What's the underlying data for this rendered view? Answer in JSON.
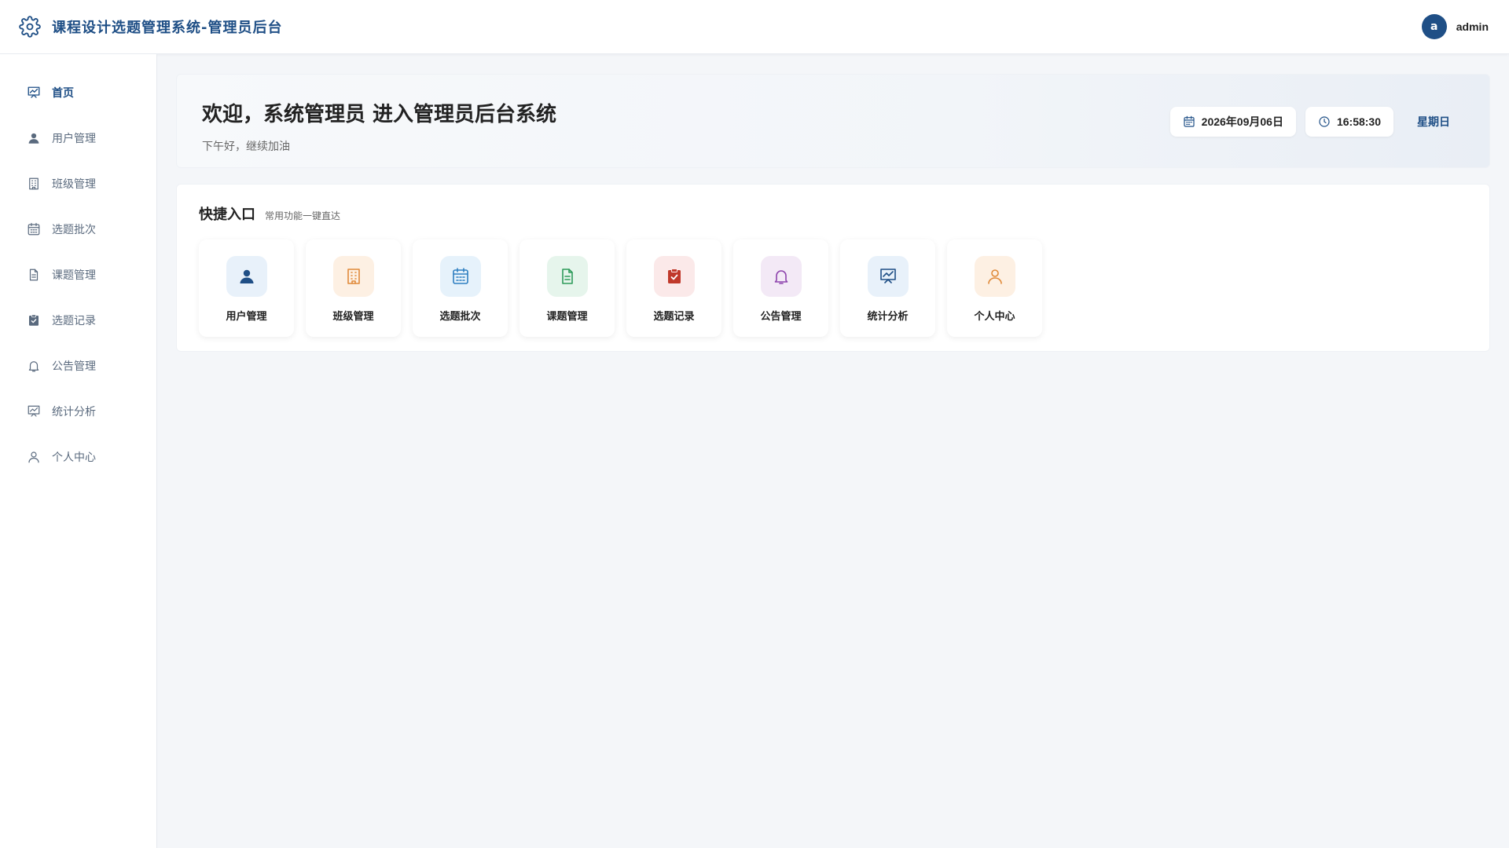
{
  "header": {
    "title": "课程设计选题管理系统-管理员后台",
    "avatar_letter": "a",
    "username": "admin"
  },
  "sidebar": {
    "items": [
      {
        "label": "首页",
        "icon": "chart-board-icon",
        "active": true
      },
      {
        "label": "用户管理",
        "icon": "user-icon"
      },
      {
        "label": "班级管理",
        "icon": "building-icon"
      },
      {
        "label": "选题批次",
        "icon": "calendar-icon"
      },
      {
        "label": "课题管理",
        "icon": "document-icon"
      },
      {
        "label": "选题记录",
        "icon": "clipboard-check-icon"
      },
      {
        "label": "公告管理",
        "icon": "bell-icon"
      },
      {
        "label": "统计分析",
        "icon": "chart-board-icon"
      },
      {
        "label": "个人中心",
        "icon": "person-outline-icon"
      }
    ]
  },
  "welcome": {
    "title": "欢迎，系统管理员 进入管理员后台系统",
    "subtitle": "下午好，继续加油",
    "date": "2026年09月06日",
    "time": "16:58:30",
    "weekday": "星期日"
  },
  "quick": {
    "title": "快捷入口",
    "subtitle": "常用功能一键直达",
    "cards": [
      {
        "label": "用户管理",
        "icon": "user-icon",
        "bg": "#e8f1fa",
        "color": "#1f4f86"
      },
      {
        "label": "班级管理",
        "icon": "building-icon",
        "bg": "#fdf0e3",
        "color": "#e08a3a"
      },
      {
        "label": "选题批次",
        "icon": "calendar-icon",
        "bg": "#e6f2fb",
        "color": "#2f7fc1"
      },
      {
        "label": "课题管理",
        "icon": "document-icon",
        "bg": "#e6f5ec",
        "color": "#2e9b5a"
      },
      {
        "label": "选题记录",
        "icon": "clipboard-check-icon",
        "bg": "#fbe9e9",
        "color": "#c0392b"
      },
      {
        "label": "公告管理",
        "icon": "bell-icon",
        "bg": "#f3e9f6",
        "color": "#8e44ad"
      },
      {
        "label": "统计分析",
        "icon": "chart-board-icon",
        "bg": "#e8f1fa",
        "color": "#1f4f86"
      },
      {
        "label": "个人中心",
        "icon": "person-outline-icon",
        "bg": "#fdf0e3",
        "color": "#e08a3a"
      }
    ]
  },
  "colors": {
    "primary": "#1f4f86",
    "text": "#222222",
    "muted": "#5a6a7e",
    "background": "#f4f6f9"
  }
}
